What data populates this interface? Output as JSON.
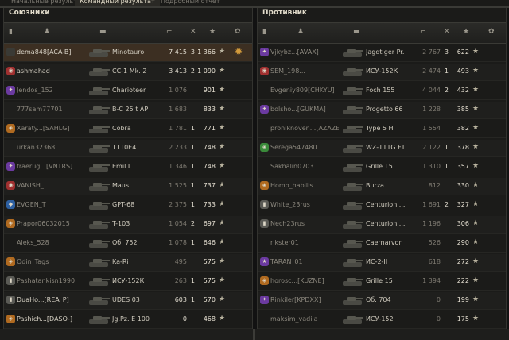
{
  "tabs": [
    {
      "label": "Начальные результаты",
      "active": false
    },
    {
      "label": "Командный результат",
      "active": true
    },
    {
      "label": "Подробный отчет",
      "active": false
    }
  ],
  "allies": {
    "title": "Союзники",
    "rows": [
      {
        "badge": "",
        "badge_color": "#3a3a35",
        "name": "dema848[ACA-B]",
        "vehicle": "Minotauro",
        "damage": "7 415",
        "kills": "3",
        "xp": "1 366",
        "dead": false,
        "me": true,
        "medal": "medal-icon"
      },
      {
        "badge": "◉",
        "badge_color": "#a03030",
        "name": "ashmahad",
        "vehicle": "CC-1 Mk. 2",
        "damage": "3 413",
        "kills": "2",
        "xp": "1 090",
        "dead": false,
        "me": false
      },
      {
        "badge": "✦",
        "badge_color": "#6b3aa0",
        "name": "Jendos_152",
        "vehicle": "Charioteer",
        "damage": "1 076",
        "kills": "",
        "xp": "901",
        "dead": true,
        "me": false
      },
      {
        "badge": "",
        "badge_color": "",
        "name": "777sam77701",
        "vehicle": "B-C 25 t AP",
        "damage": "1 683",
        "kills": "",
        "xp": "833",
        "dead": true,
        "me": false
      },
      {
        "badge": "◈",
        "badge_color": "#b06a20",
        "name": "Xaraty...[SAHLG]",
        "vehicle": "Cobra",
        "damage": "1 781",
        "kills": "1",
        "xp": "771",
        "dead": true,
        "me": false
      },
      {
        "badge": "",
        "badge_color": "",
        "name": "urkan32368",
        "vehicle": "T110E4",
        "damage": "2 233",
        "kills": "1",
        "xp": "748",
        "dead": true,
        "me": false
      },
      {
        "badge": "✦",
        "badge_color": "#6b3aa0",
        "name": "fraerug...[VNTRS]",
        "vehicle": "Emil I",
        "damage": "1 346",
        "kills": "1",
        "xp": "748",
        "dead": true,
        "me": false
      },
      {
        "badge": "◉",
        "badge_color": "#a03030",
        "name": "VANISH_",
        "vehicle": "Maus",
        "damage": "1 525",
        "kills": "1",
        "xp": "737",
        "dead": true,
        "me": false
      },
      {
        "badge": "◆",
        "badge_color": "#2d5fa0",
        "name": "EVGEN_T",
        "vehicle": "GPT-68",
        "damage": "2 375",
        "kills": "1",
        "xp": "733",
        "dead": true,
        "me": false
      },
      {
        "badge": "◈",
        "badge_color": "#b06a20",
        "name": "Prapor06032015",
        "vehicle": "T-103",
        "damage": "1 054",
        "kills": "2",
        "xp": "697",
        "dead": true,
        "me": false
      },
      {
        "badge": "",
        "badge_color": "",
        "name": "Aleks_528",
        "vehicle": "Об. 752",
        "damage": "1 078",
        "kills": "1",
        "xp": "646",
        "dead": true,
        "me": false
      },
      {
        "badge": "◈",
        "badge_color": "#b06a20",
        "name": "Odin_Tags",
        "vehicle": "Ka-Ri",
        "damage": "495",
        "kills": "",
        "xp": "575",
        "dead": true,
        "me": false
      },
      {
        "badge": "▮",
        "badge_color": "#5a5a55",
        "name": "Pashatankisn1990",
        "vehicle": "ИСУ-152К",
        "damage": "263",
        "kills": "1",
        "xp": "575",
        "dead": true,
        "me": false
      },
      {
        "badge": "▮",
        "badge_color": "#5a5a55",
        "name": "DuaHo...[REA_P]",
        "vehicle": "UDES 03",
        "damage": "603",
        "kills": "1",
        "xp": "570",
        "dead": false,
        "me": false
      },
      {
        "badge": "◈",
        "badge_color": "#b06a20",
        "name": "Pashich...[DASO-]",
        "vehicle": "Jg.Pz. E 100",
        "damage": "0",
        "kills": "",
        "xp": "468",
        "dead": false,
        "me": false
      }
    ]
  },
  "enemies": {
    "title": "Противник",
    "rows": [
      {
        "badge": "✦",
        "badge_color": "#6b3aa0",
        "name": "Vjkybz...[AVAX]",
        "vehicle": "Jagdtiger Pr.",
        "damage": "2 767",
        "kills": "3",
        "xp": "622",
        "dead": true
      },
      {
        "badge": "◉",
        "badge_color": "#a03030",
        "name": "SEM_198...",
        "vehicle": "ИСУ-152К",
        "damage": "2 474",
        "kills": "1",
        "xp": "493",
        "dead": true
      },
      {
        "badge": "",
        "badge_color": "",
        "name": "Evgeniy809[CHKYU]",
        "vehicle": "Foch 155",
        "damage": "4 044",
        "kills": "2",
        "xp": "432",
        "dead": true
      },
      {
        "badge": "✦",
        "badge_color": "#6b3aa0",
        "name": "bolsho...[GUKMA]",
        "vehicle": "Progetto 66",
        "damage": "1 228",
        "kills": "",
        "xp": "385",
        "dead": true
      },
      {
        "badge": "",
        "badge_color": "",
        "name": "proniknoven...[AZAZE]",
        "vehicle": "Type 5 H",
        "damage": "1 554",
        "kills": "",
        "xp": "382",
        "dead": true
      },
      {
        "badge": "◈",
        "badge_color": "#3a8a3a",
        "name": "Serega547480",
        "vehicle": "WZ-111G FT",
        "damage": "2 122",
        "kills": "1",
        "xp": "378",
        "dead": true
      },
      {
        "badge": "",
        "badge_color": "",
        "name": "Sakhalin0703",
        "vehicle": "Grille 15",
        "damage": "1 310",
        "kills": "1",
        "xp": "357",
        "dead": true
      },
      {
        "badge": "◈",
        "badge_color": "#b06a20",
        "name": "Homo_habilis",
        "vehicle": "Burza",
        "damage": "812",
        "kills": "",
        "xp": "330",
        "dead": true
      },
      {
        "badge": "▮",
        "badge_color": "#5a5a55",
        "name": "White_23rus",
        "vehicle": "Centurion ...",
        "damage": "1 691",
        "kills": "2",
        "xp": "327",
        "dead": true
      },
      {
        "badge": "▮",
        "badge_color": "#5a5a55",
        "name": "Nech23rus",
        "vehicle": "Centurion ...",
        "damage": "1 196",
        "kills": "",
        "xp": "306",
        "dead": true
      },
      {
        "badge": "",
        "badge_color": "",
        "name": "rikster01",
        "vehicle": "Caernarvon",
        "damage": "526",
        "kills": "",
        "xp": "290",
        "dead": true
      },
      {
        "badge": "★",
        "badge_color": "#6b3aa0",
        "name": "TARAN_01",
        "vehicle": "ИС-2-II",
        "damage": "618",
        "kills": "",
        "xp": "272",
        "dead": true
      },
      {
        "badge": "◈",
        "badge_color": "#b06a20",
        "name": "horosc...[KUZNE]",
        "vehicle": "Grille 15",
        "damage": "1 394",
        "kills": "",
        "xp": "222",
        "dead": true
      },
      {
        "badge": "✦",
        "badge_color": "#6b3aa0",
        "name": "Rinkiler[KPDXX]",
        "vehicle": "Об. 704",
        "damage": "0",
        "kills": "",
        "xp": "199",
        "dead": true
      },
      {
        "badge": "",
        "badge_color": "",
        "name": "maksim_vadila",
        "vehicle": "ИСУ-152",
        "damage": "0",
        "kills": "",
        "xp": "175",
        "dead": true
      }
    ]
  }
}
